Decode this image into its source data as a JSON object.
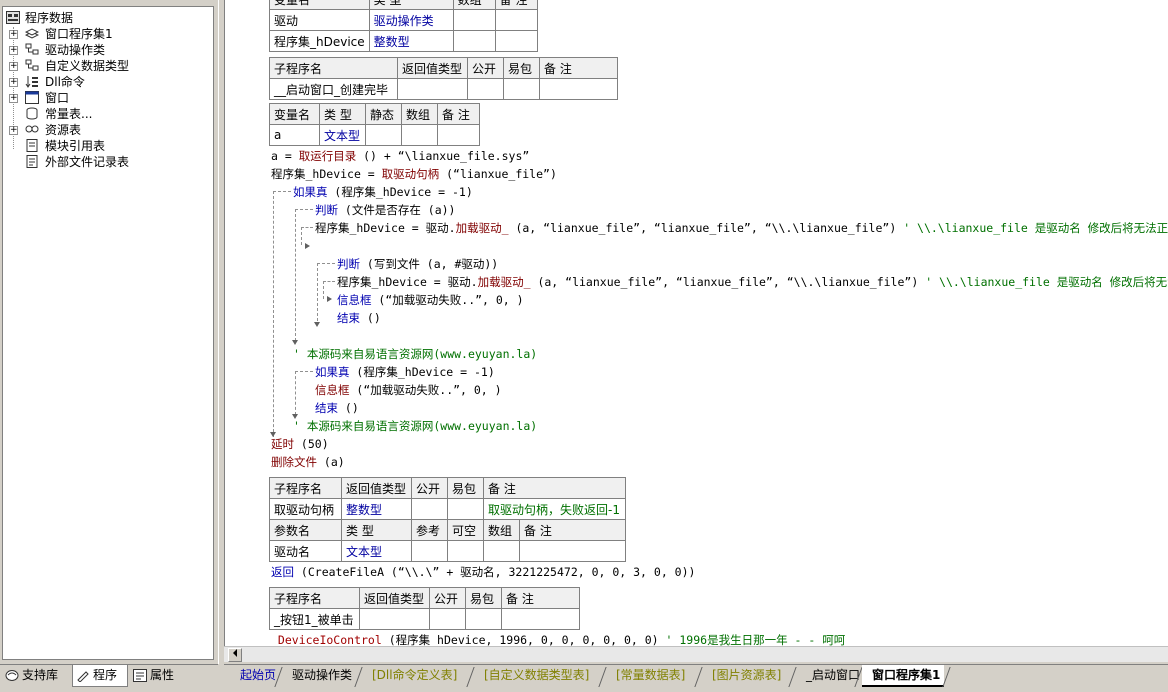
{
  "tree": {
    "root": "程序数据",
    "items": [
      {
        "label": "窗口程序集1",
        "icon": "module-stack-icon",
        "expander": true
      },
      {
        "label": "驱动操作类",
        "icon": "class-icon",
        "expander": true
      },
      {
        "label": "自定义数据类型",
        "icon": "class-icon",
        "expander": true
      },
      {
        "label": "Dll命令",
        "icon": "dll-icon",
        "expander": true
      },
      {
        "label": "窗口",
        "icon": "window-icon",
        "expander": true
      },
      {
        "label": "常量表...",
        "icon": "constant-icon",
        "expander": false
      },
      {
        "label": "资源表",
        "icon": "resource-icon",
        "expander": true
      },
      {
        "label": "模块引用表",
        "icon": "module-ref-icon",
        "expander": false
      },
      {
        "label": "外部文件记录表",
        "icon": "file-record-icon",
        "expander": false
      }
    ]
  },
  "left_tabs": [
    {
      "label": "支持库",
      "active": false
    },
    {
      "label": "程序",
      "active": true
    },
    {
      "label": "属性",
      "active": false
    }
  ],
  "tables": {
    "t1": {
      "header": [
        "变量名",
        "类 型",
        "数组",
        "备 注"
      ],
      "rows": [
        [
          "驱动",
          "驱动操作类",
          "",
          ""
        ],
        [
          "程序集_hDevice",
          "整数型",
          "",
          ""
        ]
      ]
    },
    "t2": {
      "header": [
        "子程序名",
        "返回值类型",
        "公开",
        "易包",
        "备 注"
      ],
      "rows": [
        [
          "__启动窗口_创建完毕",
          "",
          "",
          "",
          ""
        ]
      ]
    },
    "t3": {
      "header": [
        "变量名",
        "类 型",
        "静态",
        "数组",
        "备 注"
      ],
      "rows": [
        [
          "a",
          "文本型",
          "",
          "",
          ""
        ]
      ]
    },
    "t4": {
      "header": [
        "子程序名",
        "返回值类型",
        "公开",
        "易包",
        "备 注"
      ],
      "rows": [
        [
          "取驱动句柄",
          "整数型",
          "",
          "",
          "取驱动句柄，失败返回-1"
        ]
      ]
    },
    "t5": {
      "header": [
        "参数名",
        "类 型",
        "参考",
        "可空",
        "数组",
        "备 注"
      ],
      "rows": [
        [
          "驱动名",
          "文本型",
          "",
          "",
          "",
          ""
        ]
      ]
    },
    "t6": {
      "header": [
        "子程序名",
        "返回值类型",
        "公开",
        "易包",
        "备 注"
      ],
      "rows": [
        [
          "_按钮1_被单击",
          "",
          "",
          "",
          ""
        ]
      ]
    }
  },
  "code": {
    "l1_a": "a = ",
    "l1_fn": "取运行目录",
    "l1_rest": " () + “\\lianxue_file.sys”",
    "l2_a": "程序集_hDevice = ",
    "l2_fn": "取驱动句柄",
    "l2_rest": " (“lianxue_file”)",
    "l3_kw": "如果真",
    "l3_rest": " (程序集_hDevice = -1)",
    "l4_kw": "判断",
    "l4_rest": " (文件是否存在 (a))",
    "l5_a": "程序集_hDevice = 驱动.",
    "l5_fn": "加载驱动_",
    "l5_rest": " (a, “lianxue_file”, “lianxue_file”, “\\\\.\\lianxue_file”) ",
    "l5_cmt": "' \\\\.\\lianxue_file 是驱动名 修改后将无法正常加载",
    "l6_kw": "判断",
    "l6_rest": " (写到文件 (a, #驱动))",
    "l7_a": "程序集_hDevice = 驱动.",
    "l7_fn": "加载驱动_",
    "l7_rest": " (a, “lianxue_file”, “lianxue_file”, “\\\\.\\lianxue_file”) ",
    "l7_cmt": "' \\\\.\\lianxue_file 是驱动名 修改后将无法正常",
    "l8_kw": "信息框",
    "l8_rest": " (“加载驱动失败..”, 0, )",
    "l9_kw": "结束",
    "l9_rest": " ()",
    "l10_cmt": "' 本源码来自易语言资源网(www.eyuyan.la)",
    "l11_kw": "如果真",
    "l11_rest": " (程序集_hDevice = -1)",
    "l12_kw": "信息框",
    "l12_rest": " (“加载驱动失败..”, 0, )",
    "l13_kw": "结束",
    "l13_rest": " ()",
    "l14_cmt": "' 本源码来自易语言资源网(www.eyuyan.la)",
    "l15_kw": "延时",
    "l15_rest": " (50)",
    "l16_kw": "删除文件",
    "l16_rest": " (a)",
    "l17_kw": "返回",
    "l17_rest": " (CreateFileA (“\\\\.\\” + 驱动名, 3221225472, 0, 0, 3, 0, 0))",
    "l18_fn": "_DeviceIoControl",
    "l18_rest": " (程序集_hDevice, 1996, 0, 0, 0, 0, 0, 0) ",
    "l18_cmt": "' 1996是我生日那一年 - -  呵呵"
  },
  "editor_tabs": [
    {
      "label": "起始页",
      "style": "blue"
    },
    {
      "label": "驱动操作类",
      "style": "normal"
    },
    {
      "label": "[Dll命令定义表]",
      "style": "olive"
    },
    {
      "label": "[自定义数据类型表]",
      "style": "olive"
    },
    {
      "label": "[常量数据表]",
      "style": "olive"
    },
    {
      "label": "[图片资源表]",
      "style": "olive"
    },
    {
      "label": "_启动窗口",
      "style": "normal"
    },
    {
      "label": "窗口程序集1",
      "style": "active"
    }
  ],
  "colors": {
    "keyword_brown": "#800000",
    "keyword_blue": "#0000b0",
    "string_green": "#006400",
    "comment_green": "#007000",
    "type_blue": "#0000a0"
  }
}
